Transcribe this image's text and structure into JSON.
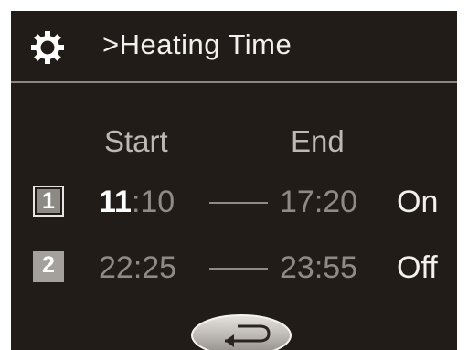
{
  "header": {
    "icon": "gear-icon",
    "breadcrumb": ">Heating Time"
  },
  "columns": {
    "start_label": "Start",
    "end_label": "End"
  },
  "slots": [
    {
      "number": "1",
      "selected": true,
      "start_hour": "11",
      "start_rest": ":10",
      "end": "17:20",
      "state": "On"
    },
    {
      "number": "2",
      "selected": false,
      "start_hour": "22",
      "start_rest": ":25",
      "end": "23:55",
      "state": "Off"
    }
  ],
  "footer": {
    "back_icon": "back-arrow-icon"
  },
  "colors": {
    "background": "#221c18",
    "text": "#f2f0ec",
    "dim_text": "#8e8a86"
  }
}
